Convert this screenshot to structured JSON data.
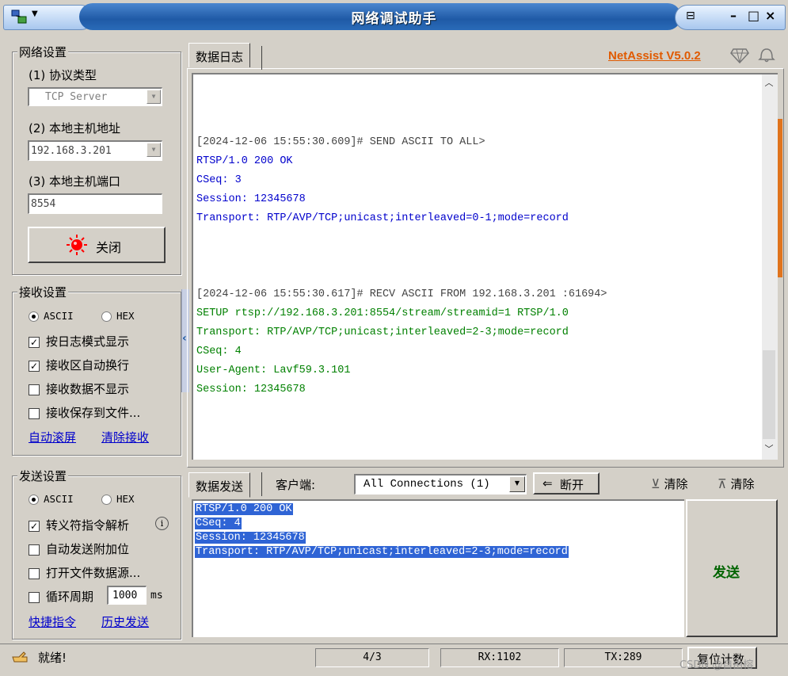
{
  "window": {
    "title": "网络调试助手"
  },
  "titlebar": {
    "pin_glyph": "⊟",
    "min_glyph": "–",
    "max_glyph": "□",
    "close_glyph": "×"
  },
  "net": {
    "group_label": "网络设置",
    "protocol_label": "(1) 协议类型",
    "protocol_value": "TCP Server",
    "host_label": "(2) 本地主机地址",
    "host_value": "192.168.3.201",
    "port_label": "(3) 本地主机端口",
    "port_value": "8554",
    "close_label": "关闭"
  },
  "recv": {
    "group_label": "接收设置",
    "ascii": "ASCII",
    "hex": "HEX",
    "opt1": "按日志模式显示",
    "opt2": "接收区自动换行",
    "opt3": "接收数据不显示",
    "opt4": "接收保存到文件...",
    "link1": "自动滚屏",
    "link2": "清除接收"
  },
  "sendset": {
    "group_label": "发送设置",
    "ascii": "ASCII",
    "hex": "HEX",
    "opt1": "转义符指令解析",
    "opt2": "自动发送附加位",
    "opt3": "打开文件数据源...",
    "opt4": "循环周期",
    "period_value": "1000",
    "period_unit": "ms",
    "link1": "快捷指令",
    "link2": "历史发送"
  },
  "log": {
    "tab_label": "数据日志",
    "brand": "NetAssist V5.0.2",
    "lines": [
      "[2024-12-06 15:55:30.609]# SEND ASCII TO ALL>",
      "RTSP/1.0 200 OK",
      "CSeq: 3",
      "Session: 12345678",
      "Transport: RTP/AVP/TCP;unicast;interleaved=0-1;mode=record",
      "[2024-12-06 15:55:30.617]# RECV ASCII FROM 192.168.3.201 :61694>",
      "SETUP rtsp://192.168.3.201:8554/stream/streamid=1 RTSP/1.0",
      "Transport: RTP/AVP/TCP;unicast;interleaved=2-3;mode=record",
      "CSeq: 4",
      "User-Agent: Lavf59.3.101",
      "Session: 12345678"
    ]
  },
  "send": {
    "tab_label": "数据发送",
    "client_label": "客户端:",
    "connections_value": "All Connections (1)",
    "disconnect_label": "断开",
    "clear1_label": "清除",
    "clear2_label": "清除",
    "send_button": "发送",
    "lines": [
      "RTSP/1.0 200 OK",
      "CSeq: 4",
      "Session: 12345678",
      "Transport: RTP/AVP/TCP;unicast;interleaved=2-3;mode=record"
    ]
  },
  "status": {
    "ready": "就绪!",
    "page": "4/3",
    "rx": "RX:1102",
    "tx": "TX:289",
    "reset": "复位计数",
    "watermark": "CSDN @自由榕"
  },
  "colors": {
    "send_log": "#0000cc",
    "recv_log": "#008000",
    "header_log": "#444444",
    "brand": "#e05a00",
    "send_button": "#006400",
    "selection": "#2f64d5"
  }
}
